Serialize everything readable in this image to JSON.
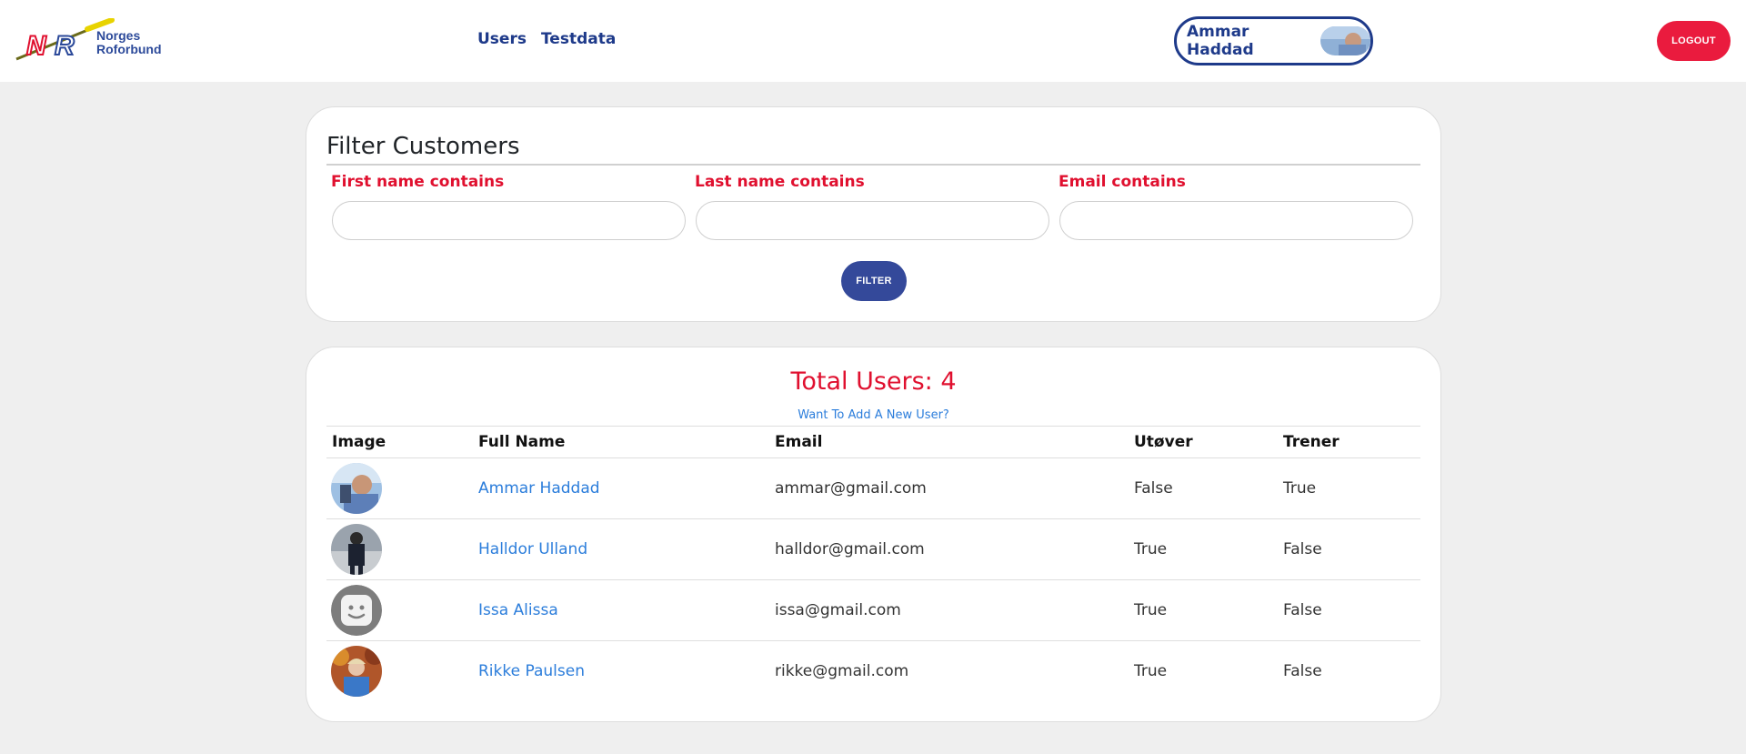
{
  "header": {
    "logo_text_line1": "Norges",
    "logo_text_line2": "Roforbund",
    "nav": [
      "Users",
      "Testdata"
    ],
    "profile_name": "Ammar Haddad",
    "logout_label": "LOGOUT"
  },
  "filter": {
    "title": "Filter Customers",
    "first_name_label": "First name contains",
    "last_name_label": "Last name contains",
    "email_label": "Email contains",
    "first_name_value": "",
    "last_name_value": "",
    "email_value": "",
    "button_label": "FILTER"
  },
  "users": {
    "total_label": "Total Users: 4",
    "add_link": "Want To Add A New User?",
    "columns": [
      "Image",
      "Full Name",
      "Email",
      "Utøver",
      "Trener"
    ],
    "rows": [
      {
        "name": "Ammar Haddad",
        "email": "ammar@gmail.com",
        "utover": "False",
        "trener": "True",
        "avatar": "photo-outdoor"
      },
      {
        "name": "Halldor Ulland",
        "email": "halldor@gmail.com",
        "utover": "True",
        "trener": "False",
        "avatar": "photo-dark"
      },
      {
        "name": "Issa Alissa",
        "email": "issa@gmail.com",
        "utover": "True",
        "trener": "False",
        "avatar": "default-avatar-icon"
      },
      {
        "name": "Rikke Paulsen",
        "email": "rikke@gmail.com",
        "utover": "True",
        "trener": "False",
        "avatar": "photo-autumn"
      }
    ]
  },
  "colors": {
    "brand_blue": "#1e3a8a",
    "accent_red": "#e0102f",
    "logout_red": "#ea1b3e",
    "filter_button": "#34499a",
    "link_blue": "#2b7ddb"
  }
}
